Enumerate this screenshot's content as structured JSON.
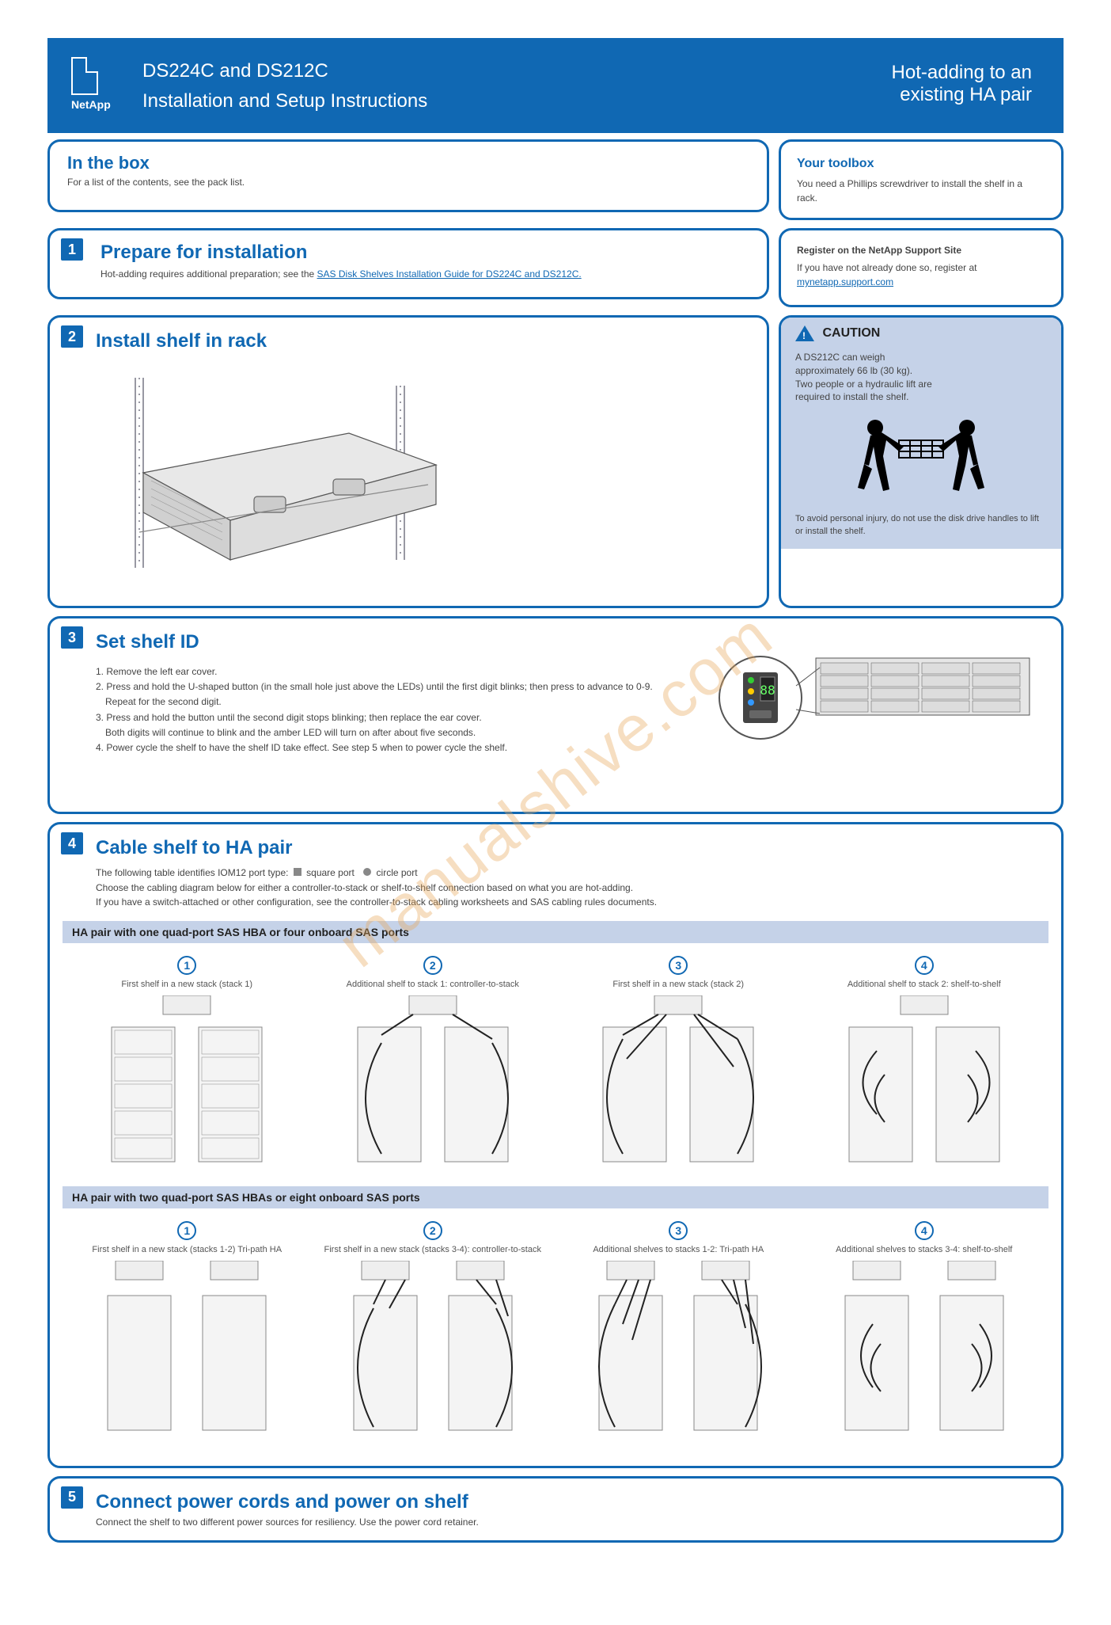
{
  "brand": "NetApp",
  "header": {
    "product": "DS224C and DS212C",
    "doc_type": "Installation and Setup Instructions",
    "right_line1": "Hot-adding to an",
    "right_line2": "existing HA pair"
  },
  "toolbox": {
    "heading": "In the box",
    "text": "For a list of the contents, see the pack list."
  },
  "prepare": {
    "num": "1",
    "title": "Prepare for installation",
    "sub_before": "Hot-adding requires additional preparation; see the ",
    "link_text": "SAS Disk Shelves Installation Guide for DS224C and DS212C.",
    "sub_after": ""
  },
  "install": {
    "num": "2",
    "title": "Install shelf in rack",
    "caution_label": "CAUTION",
    "caution_line1": "A DS212C can weigh",
    "caution_line2": "approximately 66 lb (30 kg).",
    "caution_line3": "Two people or a hydraulic lift are",
    "caution_line4": "required to install the shelf.",
    "note": "To avoid personal injury, do not use the disk drive handles to lift or install the shelf."
  },
  "set_id": {
    "num": "3",
    "title": "Set shelf ID",
    "s1": "1. Remove the left ear cover.",
    "s2": "2. Press and hold the U-shaped button (in the small hole just above the LEDs) until the first digit blinks; then press to advance to 0-9.",
    "s3": "Repeat for the second digit.",
    "s4": "3. Press and hold the button until the second digit stops blinking; then replace the ear cover.",
    "s5": "Both digits will continue to blink and the amber LED will turn on after about five seconds.",
    "s6": "4. Power cycle the shelf to have the shelf ID take effect. See step 5 when to power cycle the shelf."
  },
  "cable": {
    "num": "4",
    "title": "Cable shelf to HA pair",
    "p1_before": "The following table identifies IOM12 port type: ",
    "p1_sq": "square port",
    "p1_ci": "circle port",
    "p2": "Choose the cabling diagram below for either a controller-to-stack or shelf-to-shelf connection based on what you are hot-adding.",
    "p3": "If you have a switch-attached or other configuration, see the controller-to-stack cabling worksheets and SAS cabling rules documents.",
    "band1": "HA pair with one quad-port SAS HBA or four onboard SAS ports",
    "band2": "HA pair with two quad-port SAS HBAs or eight onboard SAS ports",
    "cols": [
      {
        "n": "1",
        "lbl": "First shelf in a new stack (stack 1)"
      },
      {
        "n": "2",
        "lbl": "Additional shelf to stack 1: controller-to-stack"
      },
      {
        "n": "3",
        "lbl": "First shelf in a new stack (stack 2)"
      },
      {
        "n": "4",
        "lbl": "Additional shelf to stack 2: shelf-to-shelf"
      }
    ],
    "cols2": [
      {
        "n": "1",
        "lbl": "First shelf in a new stack (stacks 1-2) Tri-path HA"
      },
      {
        "n": "2",
        "lbl": "First shelf in a new stack (stacks 3-4): controller-to-stack"
      },
      {
        "n": "3",
        "lbl": "Additional shelves to stacks 1-2: Tri-path HA"
      },
      {
        "n": "4",
        "lbl": "Additional shelves to stacks 3-4: shelf-to-shelf"
      }
    ]
  },
  "power": {
    "num": "5",
    "title": "Connect power cords and power on shelf",
    "sub": "Connect the shelf to two different power sources for resiliency. Use the power cord retainer."
  },
  "watermark": "manualshive.com"
}
